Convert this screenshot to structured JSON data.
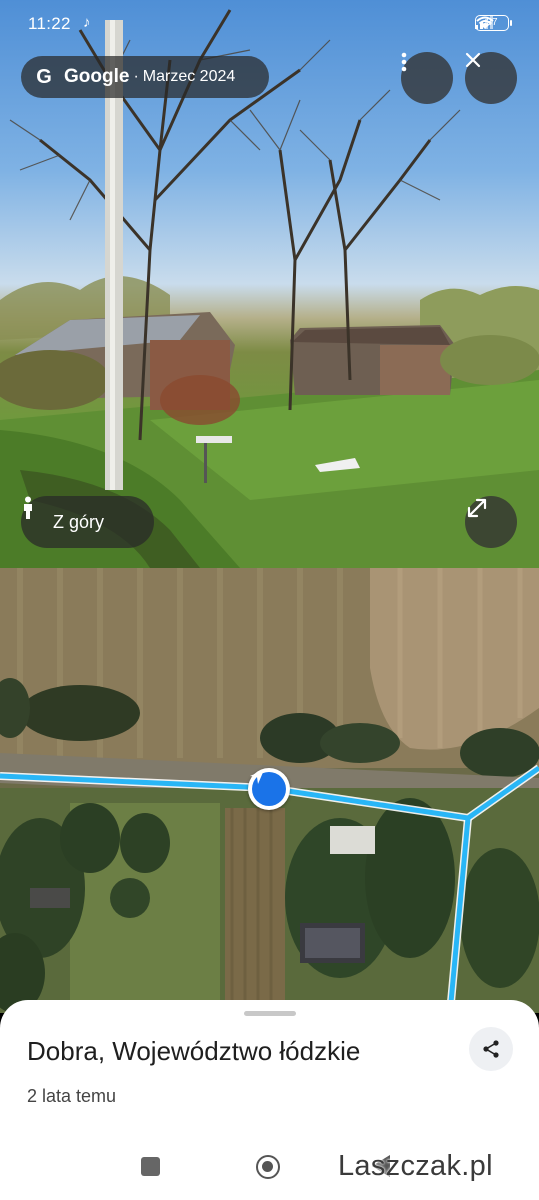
{
  "status_bar": {
    "time": "11:22",
    "battery": "37",
    "icons": [
      "tiktok-icon",
      "signal-icon",
      "wifi-icon",
      "battery-icon"
    ]
  },
  "street_view": {
    "source_logo": "G",
    "source_name": "Google",
    "separator": "·",
    "capture_date": "Marzec 2024",
    "view_mode_label": "Z góry",
    "icons": [
      "more-vert-icon",
      "close-icon",
      "person-icon",
      "expand-icon"
    ]
  },
  "map": {
    "route_color": "#29b6f6",
    "marker_color": "#1a73e8"
  },
  "sheet": {
    "title": "Dobra, Województwo łódzkie",
    "subtitle": "2 lata temu",
    "icons": [
      "share-icon"
    ]
  },
  "navigation": {
    "watermark": "Laszczak.pl",
    "icons": [
      "recent-apps-icon",
      "home-icon",
      "back-icon"
    ]
  }
}
